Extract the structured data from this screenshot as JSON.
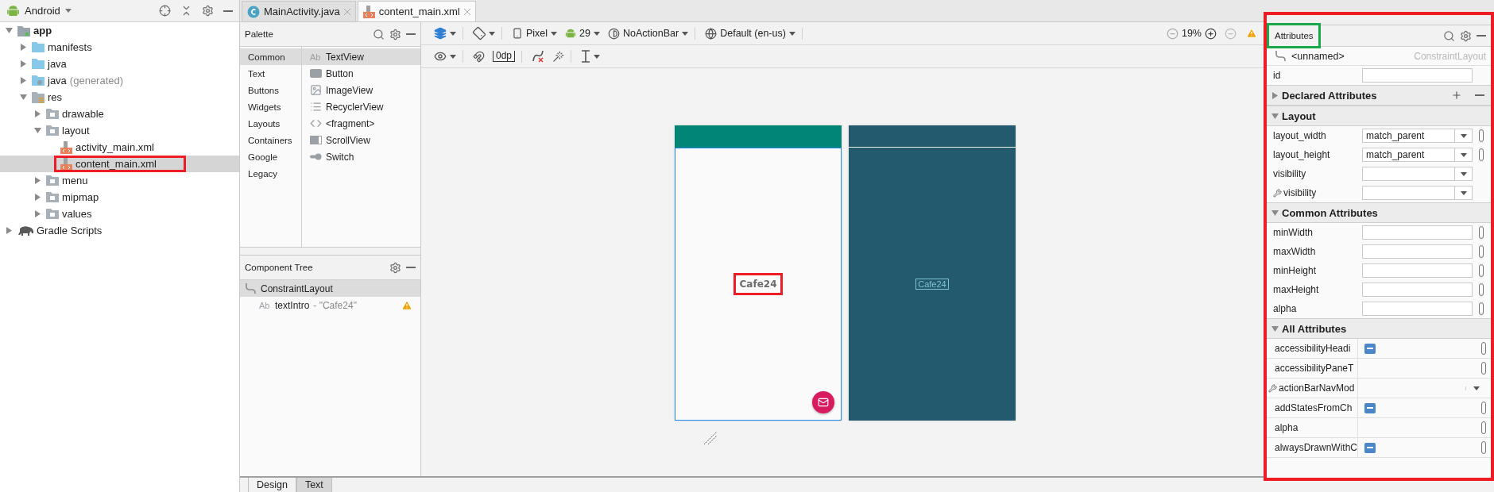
{
  "project": {
    "view_label": "Android",
    "tree": [
      {
        "label": "app",
        "kind": "module",
        "bold": true,
        "expanded": true,
        "selected": false,
        "children": [
          {
            "label": "manifests",
            "kind": "folder",
            "expanded": false,
            "selected": false
          },
          {
            "label": "java",
            "kind": "folder",
            "expanded": false,
            "selected": false
          },
          {
            "label": "java",
            "suffix": "(generated)",
            "kind": "generated",
            "expanded": false,
            "selected": false
          },
          {
            "label": "res",
            "kind": "resources",
            "expanded": true,
            "selected": false,
            "children": [
              {
                "label": "drawable",
                "kind": "package",
                "expanded": false,
                "selected": false
              },
              {
                "label": "layout",
                "kind": "package",
                "expanded": true,
                "selected": false,
                "children": [
                  {
                    "label": "activity_main.xml",
                    "kind": "xml",
                    "selected": false
                  },
                  {
                    "label": "content_main.xml",
                    "kind": "xml",
                    "selected": true,
                    "highlighted": true
                  }
                ]
              },
              {
                "label": "menu",
                "kind": "package",
                "expanded": false,
                "selected": false
              },
              {
                "label": "mipmap",
                "kind": "package",
                "expanded": false,
                "selected": false
              },
              {
                "label": "values",
                "kind": "package",
                "expanded": false,
                "selected": false
              }
            ]
          }
        ]
      },
      {
        "label": "Gradle Scripts",
        "kind": "gradle",
        "expanded": false,
        "selected": false
      }
    ]
  },
  "editor_tabs": [
    {
      "label": "MainActivity.java",
      "kind": "class",
      "selected": false
    },
    {
      "label": "content_main.xml",
      "kind": "xml",
      "selected": true
    }
  ],
  "palette": {
    "title": "Palette",
    "categories": [
      {
        "label": "Common",
        "selected": true
      },
      {
        "label": "Text",
        "selected": false
      },
      {
        "label": "Buttons",
        "selected": false
      },
      {
        "label": "Widgets",
        "selected": false
      },
      {
        "label": "Layouts",
        "selected": false
      },
      {
        "label": "Containers",
        "selected": false
      },
      {
        "label": "Google",
        "selected": false
      },
      {
        "label": "Legacy",
        "selected": false
      }
    ],
    "items": [
      {
        "label": "TextView",
        "kind": "text",
        "glyph": "Ab",
        "selected": true
      },
      {
        "label": "Button",
        "kind": "button",
        "selected": false
      },
      {
        "label": "ImageView",
        "kind": "image",
        "selected": false
      },
      {
        "label": "RecyclerView",
        "kind": "list",
        "selected": false
      },
      {
        "label": "<fragment>",
        "kind": "code",
        "selected": false
      },
      {
        "label": "ScrollView",
        "kind": "scroll",
        "selected": false
      },
      {
        "label": "Switch",
        "kind": "switch",
        "selected": false
      }
    ]
  },
  "component_tree": {
    "title": "Component Tree",
    "nodes": [
      {
        "label": "ConstraintLayout",
        "kind": "constraint",
        "selected": true,
        "children": [
          {
            "label": "textIntro",
            "detail": "- \"Cafe24\"",
            "kind": "text",
            "glyph": "Ab",
            "selected": false,
            "warning": true
          }
        ]
      }
    ]
  },
  "toolbar": {
    "rows": [
      [
        [
          {
            "kind": "layers",
            "dropdown": true
          }
        ],
        [
          {
            "kind": "rotate",
            "dropdown": true
          }
        ],
        [
          {
            "kind": "device",
            "label": "Pixel",
            "dropdown": true
          },
          {
            "kind": "api",
            "label": "29",
            "dropdown": true
          },
          {
            "kind": "theme",
            "label": "NoActionBar",
            "dropdown": true
          }
        ],
        [
          {
            "kind": "locale",
            "label": "Default (en-us)",
            "dropdown": true
          }
        ]
      ],
      [
        [
          {
            "kind": "eye",
            "dropdown": true
          }
        ],
        [
          {
            "kind": "magnet",
            "dropdown": false
          },
          {
            "kind": "margin",
            "label": "0dp",
            "dropdown": false
          }
        ],
        [
          {
            "kind": "clear",
            "dropdown": false
          },
          {
            "kind": "wand",
            "dropdown": false
          }
        ],
        [
          {
            "kind": "align",
            "dropdown": true
          }
        ]
      ]
    ],
    "zoom": "19%"
  },
  "canvas": {
    "views": [
      {
        "kind": "design",
        "text": "Cafe24",
        "highlighted": true,
        "fab": true
      },
      {
        "kind": "blueprint",
        "text": "Cafe24"
      }
    ]
  },
  "attributes": {
    "title": "Attributes",
    "title_highlighted": true,
    "panel_highlighted": true,
    "component_name": "<unnamed>",
    "component_type": "ConstraintLayout",
    "id_label": "id",
    "sections": [
      {
        "title": "Declared Attributes",
        "expanded": false,
        "actions": true
      },
      {
        "title": "Layout",
        "kind": "form",
        "expanded": true,
        "rows": [
          {
            "label": "layout_width",
            "kind": "dropdown",
            "value": "match_parent",
            "resource": true
          },
          {
            "label": "layout_height",
            "kind": "dropdown",
            "value": "match_parent",
            "resource": true
          },
          {
            "label": "visibility",
            "kind": "dropdown",
            "resource": false
          },
          {
            "label": "visibility",
            "kind": "dropdown",
            "resource": false,
            "design_time": true
          }
        ]
      },
      {
        "title": "Common Attributes",
        "kind": "form",
        "expanded": true,
        "rows": [
          {
            "label": "minWidth",
            "kind": "text",
            "resource": true
          },
          {
            "label": "maxWidth",
            "kind": "text",
            "resource": true
          },
          {
            "label": "minHeight",
            "kind": "text",
            "resource": true
          },
          {
            "label": "maxHeight",
            "kind": "text",
            "resource": true
          },
          {
            "label": "alpha",
            "kind": "text",
            "resource": true
          }
        ]
      },
      {
        "title": "All Attributes",
        "kind": "table",
        "expanded": true,
        "rows": [
          {
            "label": "accessibilityHeadi",
            "kind": "flag",
            "resource": true
          },
          {
            "label": "accessibilityPaneT",
            "kind": "plain",
            "resource": true
          },
          {
            "label": "actionBarNavMod",
            "kind": "dropdown",
            "resource": false,
            "design_time": true
          },
          {
            "label": "addStatesFromCh",
            "kind": "flag",
            "resource": true
          },
          {
            "label": "alpha",
            "kind": "plain",
            "resource": true
          },
          {
            "label": "alwaysDrawnWithC",
            "kind": "flag",
            "resource": true
          }
        ]
      }
    ]
  },
  "bottom_tabs": [
    {
      "label": "Design",
      "selected": true
    },
    {
      "label": "Text",
      "selected": false
    }
  ]
}
